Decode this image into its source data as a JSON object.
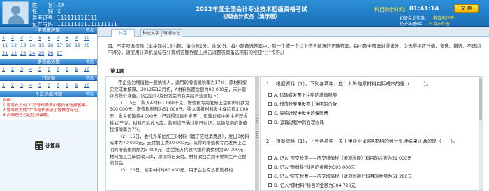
{
  "candidate": {
    "name_label": "姓　　名：",
    "name_value": "XX",
    "gender_label": "性　　别：",
    "gender_value": "X",
    "id_label": "准考证号：",
    "id_value": "111111111111",
    "cert_label": "证件号码：",
    "cert_value": "111111111111111111"
  },
  "exam": {
    "title": "2022年度全国会计专业技术初级资格考试",
    "subtitle": "初级会计实务（演示版）"
  },
  "timer": {
    "label": "科目剩余时间：",
    "value": "01:41:14"
  },
  "submit_label": "交 卷",
  "subjects": [
    {
      "label": "初级会计实务：",
      "value": "科目未作答"
    },
    {
      "label": "经济法基础：",
      "value": "科目未作答"
    }
  ],
  "left_panel": {
    "collapse_label": "收起",
    "sections": [
      {
        "title": "单项选择题",
        "numbers": [
          "1",
          "2",
          "3",
          "4",
          "5",
          "6",
          "7",
          "8",
          "9",
          "10",
          "11",
          "12",
          "13",
          "14",
          "15",
          "16",
          "17",
          "18",
          "19",
          "20",
          "21",
          "22",
          "23",
          "24",
          "25",
          "26",
          "27"
        ]
      },
      {
        "title": "多项选择题",
        "numbers": [
          "1",
          "2",
          "3",
          "4",
          "5",
          "6",
          "7",
          "8",
          "9",
          "10"
        ]
      },
      {
        "title": "判断题",
        "numbers": [
          "1",
          "2",
          "3",
          "4",
          "5",
          "6",
          "7",
          "8",
          "9",
          "10"
        ]
      },
      {
        "title": "不定项选择题",
        "numbers": []
      }
    ],
    "notes": [
      "说明:",
      "1.题号右方的“!”符号代表该小题尚未选择答案。",
      "2.题号右方的“?”符号代表该小题做过标记。",
      "3.点击题号可定位到该题。"
    ],
    "calculator_label": "计算器"
  },
  "tabs": [
    "试卷",
    "标记文字",
    "取消标记"
  ],
  "instructions": "四、不定项选择题（本类题共15小题，每小题2分，共30分。每小题备选答案中，有一个或一个以上符合题意的正确答案。每小题全部选对得满分，少选得相应分值，多选、错选、不选均不得分。请使用计算机鼠标在计算机答题界面上点击试题答案备选项前的按钮“□”作答。）",
  "question_number": "第1题",
  "material": [
    "甲企业为增值税一般纳税人，适用的增值税税率为17%，原材料按实际成本核算。2012年12月初，A材料账面余额为90 000元，未计提存货跌价准备。该企业12月份发生的有关经济业务如下：",
    "（1）5日，购入A材料1 000千克，增值税专用发票上注明的价款为300 000元，增值税税额为51 000元。购入该批材料发生保险费1 000元，发生运输费4 000元（已取得运输业发票），运输过程中发生合理损耗10千克。材料已验收入库，款项均已通过银行付讫。运输费用的增值税扣除率为7%。",
    "（2）15日，委托外单位加工B材料（属于应税消费品），发出B材料成本为70 000元，支付加工费20 000元，取得的增值税专用发票上注明的增值税税额为3 400元，由受托方代收代缴的消费税为10 000元，材料加工完毕验收入库，款项均已支付。材料收回后用于继续生产应税消费品。",
    "（3）20日，领用A材料60 000元，用于企业专设销售机构"
  ],
  "sub_questions": [
    {
      "number": "1.",
      "text": "根据资料（1），下列各项中，应计入外购原材料实际成本的是（　　　）。",
      "options": [
        "A. 运输费发票上注明的增值税额",
        "B. 增值税专用发票上注明的价款",
        "C. 采购过程中发生的保险费",
        "D. 运输过程中的合理损耗"
      ]
    },
    {
      "number": "2.",
      "text": "根据资料（1），下列各项中，关于甲企业采购A材料的会计处理结果正确的是（　　）。",
      "options": [
        "A. 记入“应交税费——应交增值税（进项税额）”科目的金额为51 000元",
        "B. 记入“原材料”科目的金额为305 000元",
        "C. 记入“应交税费——应交增值税（进项税额）”科目的金额为51 280元",
        "D. 记入“原材料”科目的金额为304 720元"
      ]
    }
  ]
}
